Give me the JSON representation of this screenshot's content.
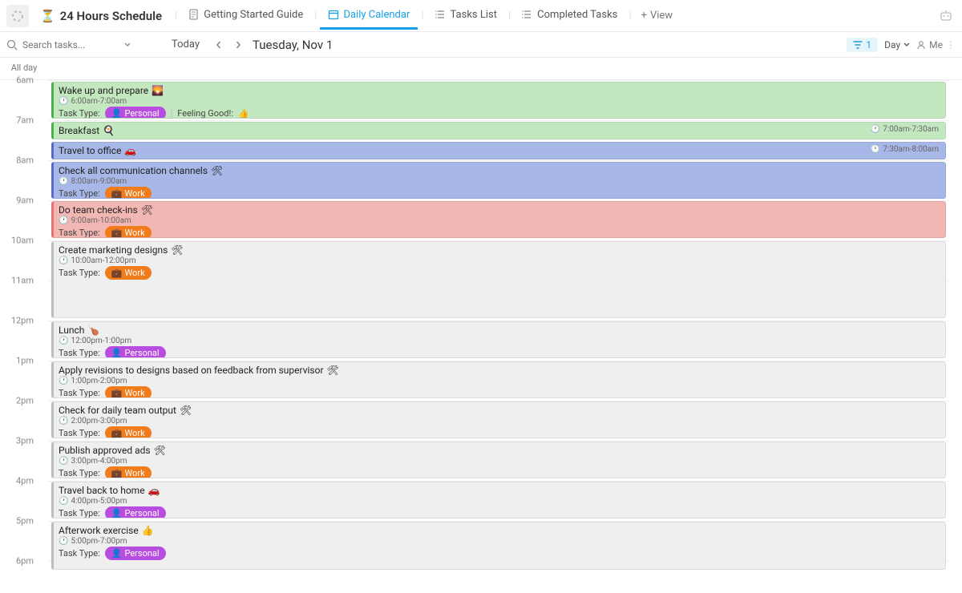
{
  "header": {
    "title": "24 Hours Schedule",
    "tabs": [
      {
        "label": "Getting Started Guide"
      },
      {
        "label": "Daily Calendar",
        "active": true
      },
      {
        "label": "Tasks List"
      },
      {
        "label": "Completed Tasks"
      }
    ],
    "view_btn": "View"
  },
  "toolbar": {
    "search_placeholder": "Search tasks...",
    "today_label": "Today",
    "date_label": "Tuesday, Nov 1",
    "filter_count": "1",
    "day_label": "Day",
    "me_label": "Me"
  },
  "allday_label": "All day",
  "hour_labels": [
    "6am",
    "7am",
    "8am",
    "9am",
    "10am",
    "11am",
    "12pm",
    "1pm",
    "2pm",
    "3pm",
    "4pm",
    "5pm",
    "6pm"
  ],
  "labels": {
    "task_type": "Task Type:",
    "feeling_good": "Feeling Good!:"
  },
  "pills": {
    "personal": "Personal",
    "work": "Work"
  },
  "events": {
    "wake": {
      "title": "Wake up and prepare",
      "emoji": "🌄",
      "time": "6:00am-7:00am"
    },
    "breakfast": {
      "title": "Breakfast",
      "emoji": "🍳",
      "time_right": "7:00am-7:30am"
    },
    "travel_office": {
      "title": "Travel to office",
      "emoji": "🚗",
      "time_right": "7:30am-8:00am"
    },
    "check_comm": {
      "title": "Check all communication channels",
      "emoji": "🛠",
      "time": "8:00am-9:00am"
    },
    "checkins": {
      "title": "Do team check-ins",
      "emoji": "🛠",
      "time": "9:00am-10:00am"
    },
    "marketing": {
      "title": "Create marketing designs",
      "emoji": "🛠",
      "time": "10:00am-12:00pm"
    },
    "lunch": {
      "title": "Lunch",
      "emoji": "🍗",
      "time": "12:00pm-1:00pm"
    },
    "revisions": {
      "title": "Apply revisions to designs based on feedback from supervisor",
      "emoji": "🛠",
      "time": "1:00pm-2:00pm"
    },
    "team_output": {
      "title": "Check for daily team output",
      "emoji": "🛠",
      "time": "2:00pm-3:00pm"
    },
    "publish": {
      "title": "Publish approved ads",
      "emoji": "🛠",
      "time": "3:00pm-4:00pm"
    },
    "travel_home": {
      "title": "Travel back to home",
      "emoji": "🚗",
      "time": "4:00pm-5:00pm"
    },
    "exercise": {
      "title": "Afterwork exercise",
      "emoji": "👍",
      "time": "5:00pm-7:00pm"
    }
  }
}
